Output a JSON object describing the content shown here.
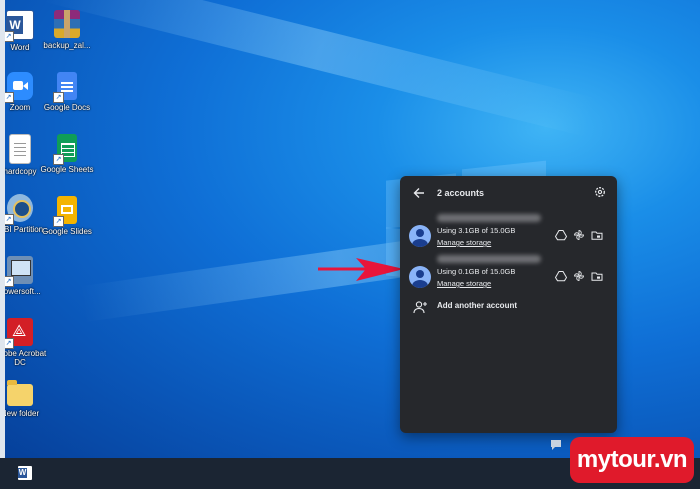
{
  "desktop": {
    "icons": [
      {
        "label": "Word",
        "glyph": "W",
        "color": "#2b579a"
      },
      {
        "label": "backup_zal...",
        "glyph": "",
        "color": "#8d2b7a"
      },
      {
        "label": "Zoom",
        "glyph": "",
        "color": "#2d8cff"
      },
      {
        "label": "Google Docs",
        "glyph": "",
        "color": "#4285f4"
      },
      {
        "label": "hardcopy",
        "glyph": "",
        "color": "#ffffff"
      },
      {
        "label": "Google Sheets",
        "glyph": "",
        "color": "#0f9d58"
      },
      {
        "label": "NIUBI Partition...",
        "glyph": "",
        "color": "#8fb8de"
      },
      {
        "label": "Google Slides",
        "glyph": "",
        "color": "#f4b400"
      },
      {
        "label": "powersoft...",
        "glyph": "",
        "color": "#6e8fb5"
      },
      {
        "label": "Adobe Acrobat DC",
        "glyph": "",
        "color": "#d31f26"
      },
      {
        "label": "New folder",
        "glyph": "",
        "color": "#f5d36b"
      }
    ]
  },
  "panel": {
    "title": "2 accounts",
    "accounts": [
      {
        "usage": "Using 3.1GB of 15.0GB",
        "manage": "Manage storage"
      },
      {
        "usage": "Using 0.1GB of 15.0GB",
        "manage": "Manage storage"
      }
    ],
    "add_account": "Add another account",
    "icons": [
      "back-arrow-icon",
      "gear-icon",
      "drive-icon",
      "pinwheel-icon",
      "folder-icon",
      "add-person-icon"
    ]
  },
  "annotation": {
    "arrow_color": "#e8153b"
  },
  "watermark": {
    "text": "mytour.vn",
    "color": "#e01a2b"
  }
}
